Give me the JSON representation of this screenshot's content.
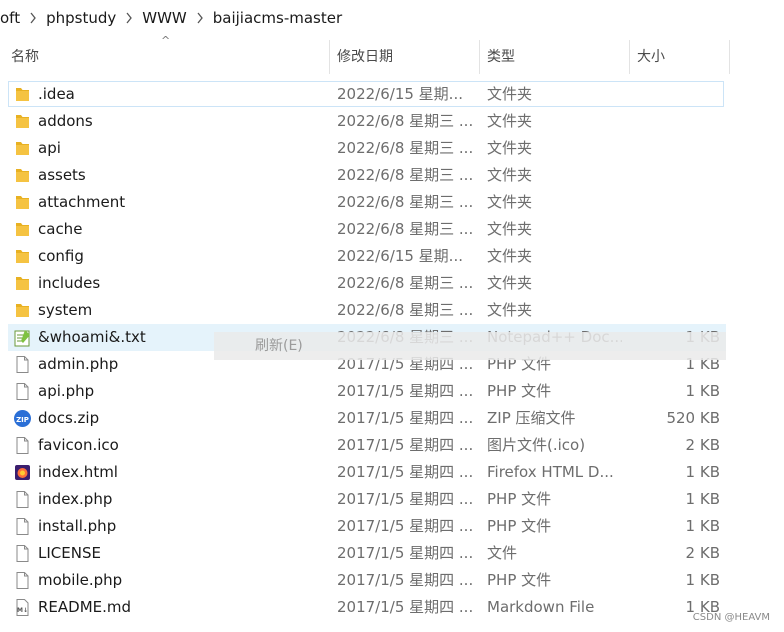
{
  "breadcrumb": [
    "oft",
    "phpstudy",
    "WWW",
    "baijiacms-master"
  ],
  "columns": {
    "name": "名称",
    "date": "修改日期",
    "type": "类型",
    "size": "大小"
  },
  "files": [
    {
      "name": ".idea",
      "date": "2022/6/15 星期...",
      "type": "文件夹",
      "size": "",
      "icon": "folder-icon"
    },
    {
      "name": "addons",
      "date": "2022/6/8 星期三 ...",
      "type": "文件夹",
      "size": "",
      "icon": "folder-icon"
    },
    {
      "name": "api",
      "date": "2022/6/8 星期三 ...",
      "type": "文件夹",
      "size": "",
      "icon": "folder-icon"
    },
    {
      "name": "assets",
      "date": "2022/6/8 星期三 ...",
      "type": "文件夹",
      "size": "",
      "icon": "folder-icon"
    },
    {
      "name": "attachment",
      "date": "2022/6/8 星期三 ...",
      "type": "文件夹",
      "size": "",
      "icon": "folder-icon"
    },
    {
      "name": "cache",
      "date": "2022/6/8 星期三 ...",
      "type": "文件夹",
      "size": "",
      "icon": "folder-icon"
    },
    {
      "name": "config",
      "date": "2022/6/15 星期...",
      "type": "文件夹",
      "size": "",
      "icon": "folder-icon"
    },
    {
      "name": "includes",
      "date": "2022/6/8 星期三 ...",
      "type": "文件夹",
      "size": "",
      "icon": "folder-icon"
    },
    {
      "name": "system",
      "date": "2022/6/8 星期三 ...",
      "type": "文件夹",
      "size": "",
      "icon": "folder-icon"
    },
    {
      "name": "&whoami&.txt",
      "date": "2022/6/8 星期三 ...",
      "type": "Notepad++ Doc...",
      "size": "1 KB",
      "icon": "notepad-file-icon"
    },
    {
      "name": "admin.php",
      "date": "2017/1/5 星期四 ...",
      "type": "PHP 文件",
      "size": "1 KB",
      "icon": "file-icon"
    },
    {
      "name": "api.php",
      "date": "2017/1/5 星期四 ...",
      "type": "PHP 文件",
      "size": "1 KB",
      "icon": "file-icon"
    },
    {
      "name": "docs.zip",
      "date": "2017/1/5 星期四 ...",
      "type": "ZIP 压缩文件",
      "size": "520 KB",
      "icon": "zip-file-icon"
    },
    {
      "name": "favicon.ico",
      "date": "2017/1/5 星期四 ...",
      "type": "图片文件(.ico)",
      "size": "2 KB",
      "icon": "file-icon"
    },
    {
      "name": "index.html",
      "date": "2017/1/5 星期四 ...",
      "type": "Firefox HTML D...",
      "size": "1 KB",
      "icon": "firefox-file-icon"
    },
    {
      "name": "index.php",
      "date": "2017/1/5 星期四 ...",
      "type": "PHP 文件",
      "size": "1 KB",
      "icon": "file-icon"
    },
    {
      "name": "install.php",
      "date": "2017/1/5 星期四 ...",
      "type": "PHP 文件",
      "size": "1 KB",
      "icon": "file-icon"
    },
    {
      "name": "LICENSE",
      "date": "2017/1/5 星期四 ...",
      "type": "文件",
      "size": "2 KB",
      "icon": "file-icon"
    },
    {
      "name": "mobile.php",
      "date": "2017/1/5 星期四 ...",
      "type": "PHP 文件",
      "size": "1 KB",
      "icon": "file-icon"
    },
    {
      "name": "README.md",
      "date": "2017/1/5 星期四 ...",
      "type": "Markdown File",
      "size": "1 KB",
      "icon": "markdown-file-icon"
    }
  ],
  "context_menu": {
    "refresh_label": "刷新(E)"
  },
  "watermark": "CSDN @HEAVM",
  "colors": {
    "folder": "#f5c342",
    "selection_border": "#cce4f7",
    "hover": "#e5f3fb"
  }
}
